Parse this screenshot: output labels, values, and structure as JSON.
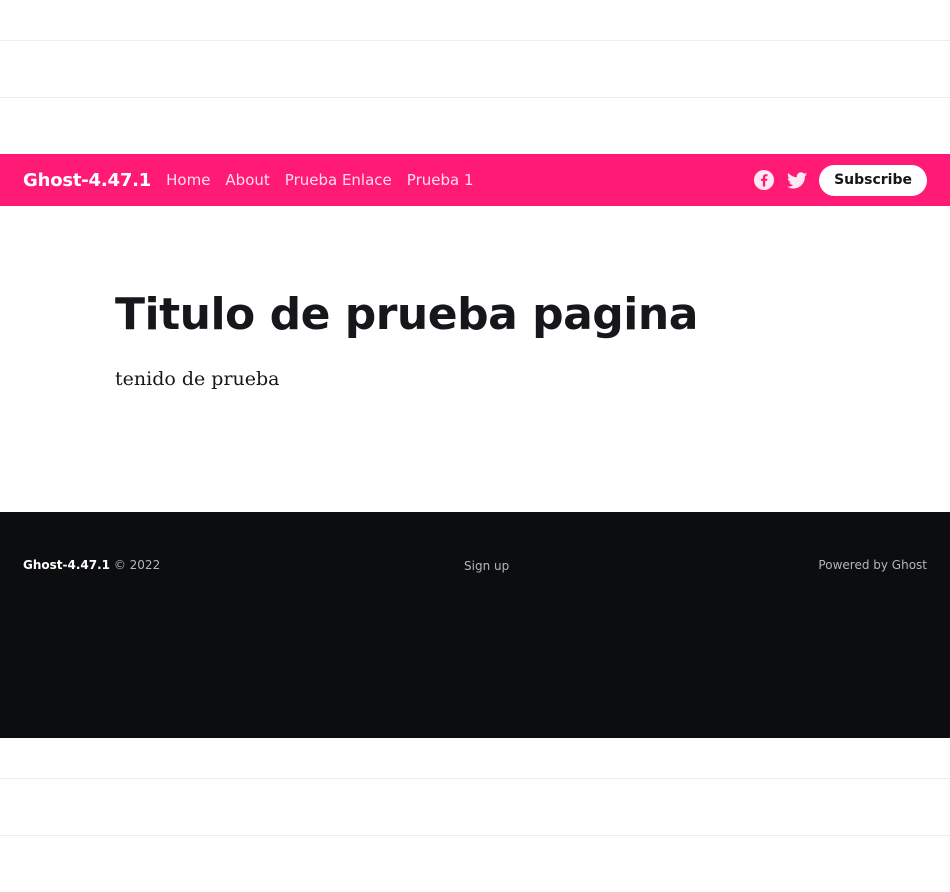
{
  "site": {
    "title": "Ghost-4.47.1",
    "accent_color": "#ff1a75"
  },
  "nav": {
    "links": [
      {
        "label": "Home"
      },
      {
        "label": "About"
      },
      {
        "label": "Prueba Enlace"
      },
      {
        "label": "Prueba 1"
      }
    ],
    "social_icons": [
      "facebook-icon",
      "twitter-icon"
    ],
    "subscribe_label": "Subscribe"
  },
  "main": {
    "title": "Titulo de prueba pagina",
    "body": "tenido de prueba"
  },
  "footer": {
    "brand": "Ghost-4.47.1",
    "copyright": "© 2022",
    "signup_label": "Sign up",
    "powered_by": "Powered by Ghost",
    "background_color": "#0c0d0f"
  }
}
